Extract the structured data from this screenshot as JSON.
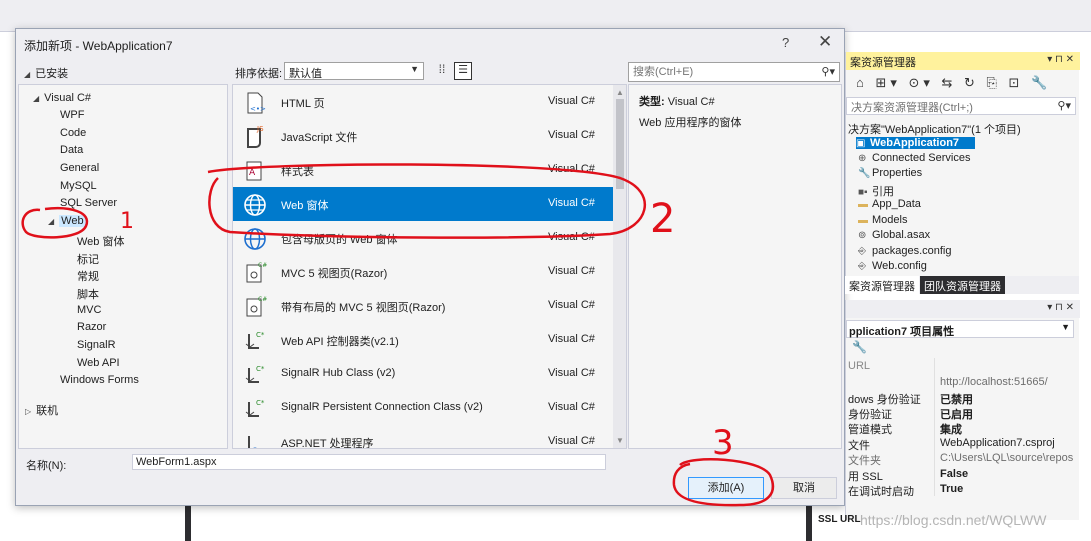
{
  "dialog": {
    "title": "添加新项 - WebApplication7",
    "help": "?",
    "close": "✕",
    "installed": "已安装",
    "sort_label": "排序依据:",
    "sort_value": "默认值",
    "search_placeholder": "搜索(Ctrl+E)",
    "name_label": "名称(N):",
    "name_value": "WebForm1.aspx",
    "add_button": "添加(A)",
    "cancel_button": "取消"
  },
  "tree": {
    "visual_csharp": "Visual C#",
    "items_top": [
      "WPF",
      "Code",
      "Data",
      "General",
      "MySQL",
      "SQL Server"
    ],
    "web": "Web",
    "web_children": [
      "Web 窗体",
      "标记",
      "常规",
      "脚本",
      "MVC",
      "Razor",
      "SignalR",
      "Web API"
    ],
    "windows_forms": "Windows Forms",
    "online": "联机"
  },
  "templates": [
    {
      "name": "HTML 页",
      "lang": "Visual C#",
      "icon": "html-page-icon"
    },
    {
      "name": "JavaScript 文件",
      "lang": "Visual C#",
      "icon": "javascript-file-icon"
    },
    {
      "name": "样式表",
      "lang": "Visual C#",
      "icon": "stylesheet-icon"
    },
    {
      "name": "Web 窗体",
      "lang": "Visual C#",
      "icon": "globe-icon"
    },
    {
      "name": "包含母版页的 Web 窗体",
      "lang": "Visual C#",
      "icon": "globe-icon"
    },
    {
      "name": "MVC 5 视图页(Razor)",
      "lang": "Visual C#",
      "icon": "razor-view-icon"
    },
    {
      "name": "带有布局的 MVC 5 视图页(Razor)",
      "lang": "Visual C#",
      "icon": "razor-view-icon"
    },
    {
      "name": "Web API 控制器类(v2.1)",
      "lang": "Visual C#",
      "icon": "csharp-class-icon"
    },
    {
      "name": "SignalR Hub Class (v2)",
      "lang": "Visual C#",
      "icon": "csharp-class-icon"
    },
    {
      "name": "SignalR Persistent Connection Class (v2)",
      "lang": "Visual C#",
      "icon": "csharp-class-icon"
    },
    {
      "name": "ASP.NET 处理程序",
      "lang": "Visual C#",
      "icon": "handler-icon"
    }
  ],
  "details": {
    "type_label": "类型:",
    "type_value": "Visual C#",
    "description": "Web 应用程序的窗体"
  },
  "solution_explorer": {
    "title": "案资源管理器",
    "pins": "▾ ⊓ ✕",
    "toolbar": "⌂ ⊞▾ ⊙▾ ⇆ ↻ ⎘ ⊡ 🔧",
    "search_placeholder": "决方案资源管理器(Ctrl+;)",
    "solution": "决方案\"WebApplication7\"(1 个项目)",
    "project": "WebApplication7",
    "items": [
      "Connected Services",
      "Properties",
      "引用",
      "App_Data",
      "Models",
      "Global.asax",
      "packages.config",
      "Web.config"
    ],
    "tab1": "案资源管理器",
    "tab2": "团队资源管理器"
  },
  "properties": {
    "pins": "▾ ⊓ ✕",
    "object": "pplication7 项目属性",
    "rows": [
      {
        "k": "URL",
        "v": ""
      },
      {
        "k": "",
        "v": "http://localhost:51665/"
      },
      {
        "k": "dows 身份验证",
        "v": "已禁用"
      },
      {
        "k": "身份验证",
        "v": "已启用"
      },
      {
        "k": "管道模式",
        "v": "集成"
      },
      {
        "k": "文件",
        "v": "WebApplication7.csproj"
      },
      {
        "k": "文件夹",
        "v": "C:\\Users\\LQL\\source\\repos"
      },
      {
        "k": "用 SSL",
        "v": "False"
      },
      {
        "k": "在调试时启动",
        "v": "True"
      }
    ],
    "ssl_url": "SSL URL"
  },
  "annotations": [
    "1",
    "2",
    "3"
  ],
  "watermark": "https://blog.csdn.net/WQLWW",
  "colors": {
    "accent": "#007acc",
    "annotation": "#e0101a",
    "selection_tree": "#cce8ff"
  }
}
